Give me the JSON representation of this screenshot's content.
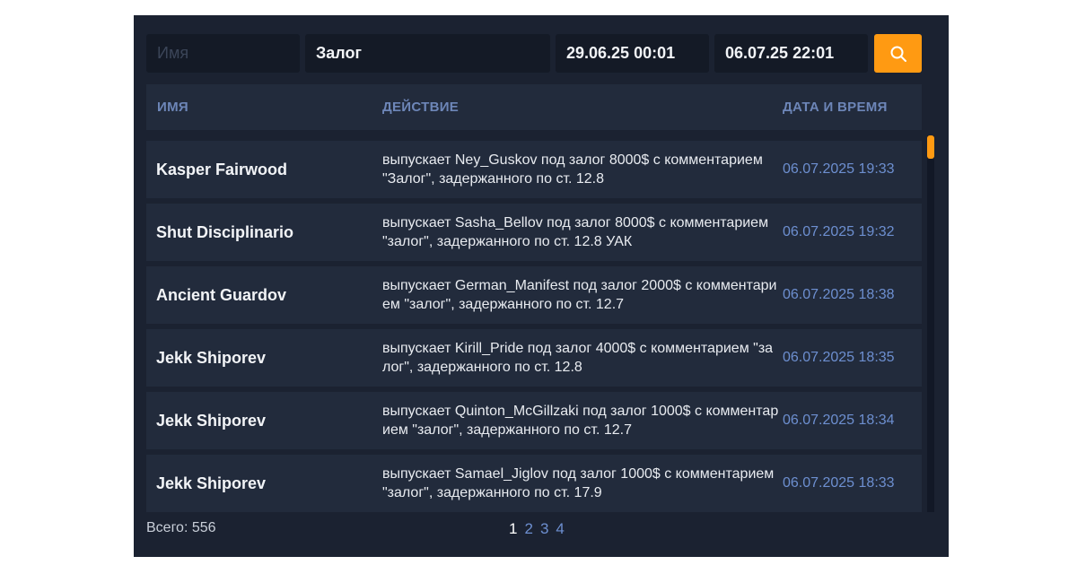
{
  "filters": {
    "name_placeholder": "Имя",
    "name_value": "",
    "action_value": "Залог",
    "date_from": "29.06.25 00:01",
    "date_to": "06.07.25 22:01",
    "search_icon": "search-icon"
  },
  "table": {
    "columns": [
      "ИМЯ",
      "ДЕЙСТВИЕ",
      "ДАТА И ВРЕМЯ"
    ],
    "rows": [
      {
        "name": "Kasper Fairwood",
        "action": "выпускает Ney_Guskov под залог 8000$ с комментарием \"Залог\", задержанного по ст. 12.8",
        "date": "06.07.2025 19:33"
      },
      {
        "name": "Shut Disciplinario",
        "action": "выпускает Sasha_Bellov под залог 8000$ с комментарием \"залог\", задержанного по ст. 12.8 УАК",
        "date": "06.07.2025 19:32"
      },
      {
        "name": "Ancient Guardov",
        "action": "выпускает German_Manifest под залог 2000$ с комментарием \"залог\", задержанного по ст. 12.7",
        "date": "06.07.2025 18:38"
      },
      {
        "name": "Jekk Shiporev",
        "action": "выпускает Kirill_Pride под залог 4000$ с комментарием \"залог\", задержанного по ст. 12.8",
        "date": "06.07.2025 18:35"
      },
      {
        "name": "Jekk Shiporev",
        "action": "выпускает Quinton_McGillzaki под залог 1000$ с комментарием \"залог\", задержанного по ст. 12.7",
        "date": "06.07.2025 18:34"
      },
      {
        "name": "Jekk Shiporev",
        "action": "выпускает Samael_Jiglov под залог 1000$ с комментарием \"залог\", задержанного по ст. 17.9",
        "date": "06.07.2025 18:33"
      }
    ]
  },
  "footer": {
    "total": "Всего: 556",
    "pages": [
      "1",
      "2",
      "3",
      "4"
    ],
    "current_page": "1"
  },
  "colors": {
    "panel": "#1b2231",
    "row": "#222b3c",
    "accent": "#ff9a12",
    "date": "#6d8fd0",
    "header_text": "#6d86b8"
  }
}
